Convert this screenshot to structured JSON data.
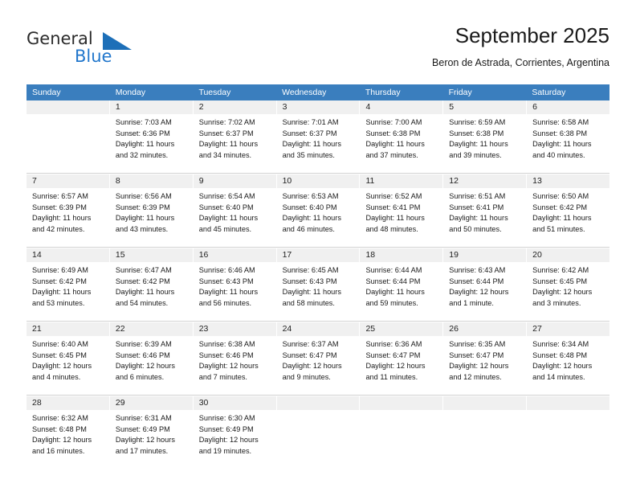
{
  "logo": {
    "word_dark": "General",
    "word_blue": "Blue",
    "triangle_color": "#1d6fb8",
    "blue_color": "#2277cc"
  },
  "header": {
    "title": "September 2025",
    "subtitle": "Beron de Astrada, Corrientes, Argentina"
  },
  "theme": {
    "header_bg": "#3a7ebe",
    "day_strip_bg": "#f0f0f0",
    "text": "#1a1a1a"
  },
  "weekdays": [
    "Sunday",
    "Monday",
    "Tuesday",
    "Wednesday",
    "Thursday",
    "Friday",
    "Saturday"
  ],
  "weeks": [
    [
      {
        "day": "",
        "sunrise": "",
        "sunset": "",
        "daylight_1": "",
        "daylight_2": "",
        "empty": true
      },
      {
        "day": "1",
        "sunrise": "Sunrise: 7:03 AM",
        "sunset": "Sunset: 6:36 PM",
        "daylight_1": "Daylight: 11 hours",
        "daylight_2": "and 32 minutes."
      },
      {
        "day": "2",
        "sunrise": "Sunrise: 7:02 AM",
        "sunset": "Sunset: 6:37 PM",
        "daylight_1": "Daylight: 11 hours",
        "daylight_2": "and 34 minutes."
      },
      {
        "day": "3",
        "sunrise": "Sunrise: 7:01 AM",
        "sunset": "Sunset: 6:37 PM",
        "daylight_1": "Daylight: 11 hours",
        "daylight_2": "and 35 minutes."
      },
      {
        "day": "4",
        "sunrise": "Sunrise: 7:00 AM",
        "sunset": "Sunset: 6:38 PM",
        "daylight_1": "Daylight: 11 hours",
        "daylight_2": "and 37 minutes."
      },
      {
        "day": "5",
        "sunrise": "Sunrise: 6:59 AM",
        "sunset": "Sunset: 6:38 PM",
        "daylight_1": "Daylight: 11 hours",
        "daylight_2": "and 39 minutes."
      },
      {
        "day": "6",
        "sunrise": "Sunrise: 6:58 AM",
        "sunset": "Sunset: 6:38 PM",
        "daylight_1": "Daylight: 11 hours",
        "daylight_2": "and 40 minutes."
      }
    ],
    [
      {
        "day": "7",
        "sunrise": "Sunrise: 6:57 AM",
        "sunset": "Sunset: 6:39 PM",
        "daylight_1": "Daylight: 11 hours",
        "daylight_2": "and 42 minutes."
      },
      {
        "day": "8",
        "sunrise": "Sunrise: 6:56 AM",
        "sunset": "Sunset: 6:39 PM",
        "daylight_1": "Daylight: 11 hours",
        "daylight_2": "and 43 minutes."
      },
      {
        "day": "9",
        "sunrise": "Sunrise: 6:54 AM",
        "sunset": "Sunset: 6:40 PM",
        "daylight_1": "Daylight: 11 hours",
        "daylight_2": "and 45 minutes."
      },
      {
        "day": "10",
        "sunrise": "Sunrise: 6:53 AM",
        "sunset": "Sunset: 6:40 PM",
        "daylight_1": "Daylight: 11 hours",
        "daylight_2": "and 46 minutes."
      },
      {
        "day": "11",
        "sunrise": "Sunrise: 6:52 AM",
        "sunset": "Sunset: 6:41 PM",
        "daylight_1": "Daylight: 11 hours",
        "daylight_2": "and 48 minutes."
      },
      {
        "day": "12",
        "sunrise": "Sunrise: 6:51 AM",
        "sunset": "Sunset: 6:41 PM",
        "daylight_1": "Daylight: 11 hours",
        "daylight_2": "and 50 minutes."
      },
      {
        "day": "13",
        "sunrise": "Sunrise: 6:50 AM",
        "sunset": "Sunset: 6:42 PM",
        "daylight_1": "Daylight: 11 hours",
        "daylight_2": "and 51 minutes."
      }
    ],
    [
      {
        "day": "14",
        "sunrise": "Sunrise: 6:49 AM",
        "sunset": "Sunset: 6:42 PM",
        "daylight_1": "Daylight: 11 hours",
        "daylight_2": "and 53 minutes."
      },
      {
        "day": "15",
        "sunrise": "Sunrise: 6:47 AM",
        "sunset": "Sunset: 6:42 PM",
        "daylight_1": "Daylight: 11 hours",
        "daylight_2": "and 54 minutes."
      },
      {
        "day": "16",
        "sunrise": "Sunrise: 6:46 AM",
        "sunset": "Sunset: 6:43 PM",
        "daylight_1": "Daylight: 11 hours",
        "daylight_2": "and 56 minutes."
      },
      {
        "day": "17",
        "sunrise": "Sunrise: 6:45 AM",
        "sunset": "Sunset: 6:43 PM",
        "daylight_1": "Daylight: 11 hours",
        "daylight_2": "and 58 minutes."
      },
      {
        "day": "18",
        "sunrise": "Sunrise: 6:44 AM",
        "sunset": "Sunset: 6:44 PM",
        "daylight_1": "Daylight: 11 hours",
        "daylight_2": "and 59 minutes."
      },
      {
        "day": "19",
        "sunrise": "Sunrise: 6:43 AM",
        "sunset": "Sunset: 6:44 PM",
        "daylight_1": "Daylight: 12 hours",
        "daylight_2": "and 1 minute."
      },
      {
        "day": "20",
        "sunrise": "Sunrise: 6:42 AM",
        "sunset": "Sunset: 6:45 PM",
        "daylight_1": "Daylight: 12 hours",
        "daylight_2": "and 3 minutes."
      }
    ],
    [
      {
        "day": "21",
        "sunrise": "Sunrise: 6:40 AM",
        "sunset": "Sunset: 6:45 PM",
        "daylight_1": "Daylight: 12 hours",
        "daylight_2": "and 4 minutes."
      },
      {
        "day": "22",
        "sunrise": "Sunrise: 6:39 AM",
        "sunset": "Sunset: 6:46 PM",
        "daylight_1": "Daylight: 12 hours",
        "daylight_2": "and 6 minutes."
      },
      {
        "day": "23",
        "sunrise": "Sunrise: 6:38 AM",
        "sunset": "Sunset: 6:46 PM",
        "daylight_1": "Daylight: 12 hours",
        "daylight_2": "and 7 minutes."
      },
      {
        "day": "24",
        "sunrise": "Sunrise: 6:37 AM",
        "sunset": "Sunset: 6:47 PM",
        "daylight_1": "Daylight: 12 hours",
        "daylight_2": "and 9 minutes."
      },
      {
        "day": "25",
        "sunrise": "Sunrise: 6:36 AM",
        "sunset": "Sunset: 6:47 PM",
        "daylight_1": "Daylight: 12 hours",
        "daylight_2": "and 11 minutes."
      },
      {
        "day": "26",
        "sunrise": "Sunrise: 6:35 AM",
        "sunset": "Sunset: 6:47 PM",
        "daylight_1": "Daylight: 12 hours",
        "daylight_2": "and 12 minutes."
      },
      {
        "day": "27",
        "sunrise": "Sunrise: 6:34 AM",
        "sunset": "Sunset: 6:48 PM",
        "daylight_1": "Daylight: 12 hours",
        "daylight_2": "and 14 minutes."
      }
    ],
    [
      {
        "day": "28",
        "sunrise": "Sunrise: 6:32 AM",
        "sunset": "Sunset: 6:48 PM",
        "daylight_1": "Daylight: 12 hours",
        "daylight_2": "and 16 minutes."
      },
      {
        "day": "29",
        "sunrise": "Sunrise: 6:31 AM",
        "sunset": "Sunset: 6:49 PM",
        "daylight_1": "Daylight: 12 hours",
        "daylight_2": "and 17 minutes."
      },
      {
        "day": "30",
        "sunrise": "Sunrise: 6:30 AM",
        "sunset": "Sunset: 6:49 PM",
        "daylight_1": "Daylight: 12 hours",
        "daylight_2": "and 19 minutes."
      },
      {
        "day": "",
        "sunrise": "",
        "sunset": "",
        "daylight_1": "",
        "daylight_2": "",
        "empty": true
      },
      {
        "day": "",
        "sunrise": "",
        "sunset": "",
        "daylight_1": "",
        "daylight_2": "",
        "empty": true
      },
      {
        "day": "",
        "sunrise": "",
        "sunset": "",
        "daylight_1": "",
        "daylight_2": "",
        "empty": true
      },
      {
        "day": "",
        "sunrise": "",
        "sunset": "",
        "daylight_1": "",
        "daylight_2": "",
        "empty": true
      }
    ]
  ]
}
